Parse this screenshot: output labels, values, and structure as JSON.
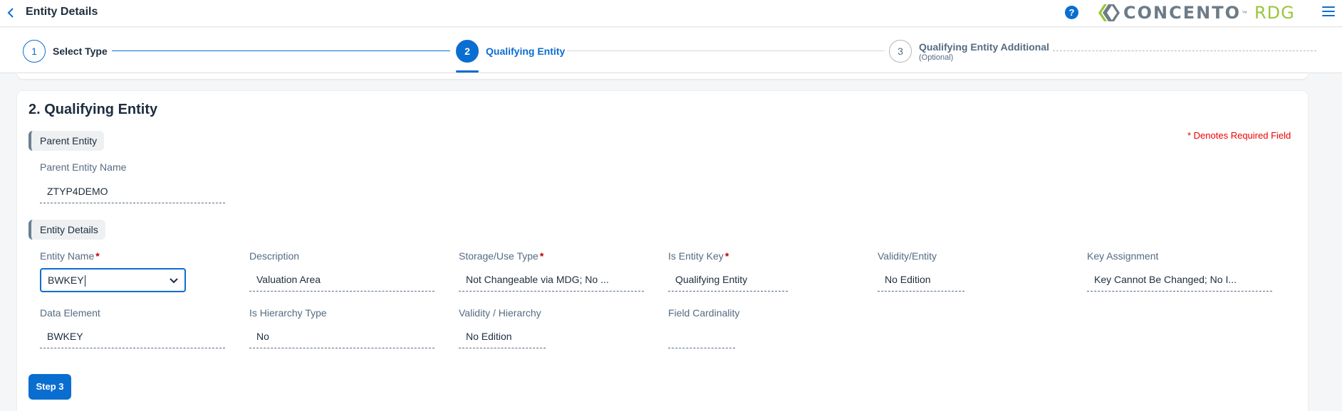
{
  "header": {
    "title": "Entity Details",
    "help_label": "?",
    "logo_text": "CONCENTO",
    "logo_tm": "™",
    "logo_suffix": "RDG",
    "brand_gray": "#6d7b86",
    "brand_green": "#9bc53d"
  },
  "wizard": {
    "steps": [
      {
        "number": "1",
        "label": "Select Type",
        "state": "done"
      },
      {
        "number": "2",
        "label": "Qualifying Entity",
        "state": "active"
      },
      {
        "number": "3",
        "label": "Qualifying Entity Additional",
        "sublabel": "(Optional)",
        "state": "inactive"
      }
    ]
  },
  "section": {
    "title": "2. Qualifying Entity",
    "required_note": "* Denotes Required Field"
  },
  "parent_group": {
    "title": "Parent Entity",
    "fields": {
      "parent_entity_name": {
        "label": "Parent Entity Name",
        "value": "ZTYP4DEMO"
      }
    }
  },
  "details_group": {
    "title": "Entity Details",
    "fields": {
      "entity_name": {
        "label": "Entity Name",
        "required": "*",
        "value": "BWKEY"
      },
      "description": {
        "label": "Description",
        "value": "Valuation Area"
      },
      "storage_use_type": {
        "label": "Storage/Use Type",
        "required": "*",
        "value": "Not Changeable via MDG; No ..."
      },
      "is_entity_key": {
        "label": "Is Entity Key",
        "required": "*",
        "value": "Qualifying Entity"
      },
      "validity_entity": {
        "label": "Validity/Entity",
        "value": "No Edition"
      },
      "key_assignment": {
        "label": "Key Assignment",
        "value": "Key Cannot Be Changed; No I..."
      },
      "data_element": {
        "label": "Data Element",
        "value": "BWKEY"
      },
      "is_hierarchy_type": {
        "label": "Is Hierarchy Type",
        "value": "No"
      },
      "validity_hierarchy": {
        "label": "Validity / Hierarchy",
        "value": "No Edition"
      },
      "field_cardinality": {
        "label": "Field Cardinality",
        "value": ""
      }
    }
  },
  "actions": {
    "step3_label": "Step 3"
  },
  "colors": {
    "accent": "#0a6ed1",
    "required": "#bb0000",
    "required_note": "#ee0000"
  }
}
